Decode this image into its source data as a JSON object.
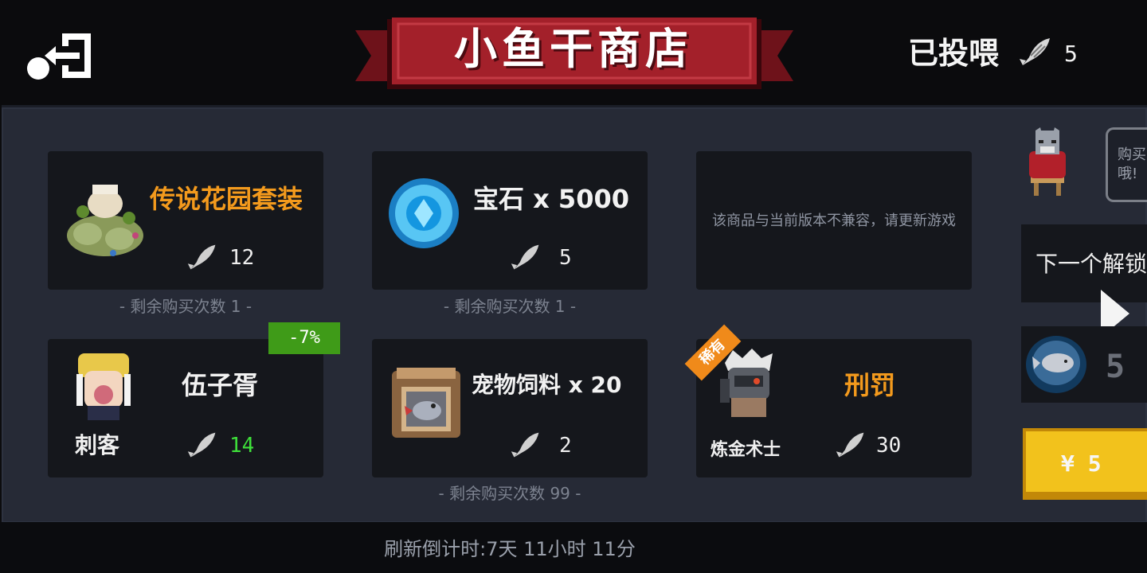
{
  "header": {
    "title": "小鱼干商店",
    "fed_label": "已投喂",
    "fed_count": "5"
  },
  "items": [
    {
      "name": "传说花园套装",
      "price": "12",
      "remaining": "- 剩余购买次数 1 -"
    },
    {
      "name": "宝石 x 5000",
      "price": "5",
      "remaining": "- 剩余购买次数 1 -"
    },
    {
      "incompatible_text": "该商品与当前版本不兼容，请更新游戏"
    },
    {
      "name": "伍子胥",
      "class_label": "刺客",
      "price": "14",
      "discount": "-7%"
    },
    {
      "name": "宠物饲料 x 20",
      "price": "2",
      "remaining": "- 剩余购买次数 99 -"
    },
    {
      "name": "刑罚",
      "class_label": "炼金术士",
      "price": "30",
      "tag": "稀有"
    }
  ],
  "side": {
    "speech_text": "购买\n哦!",
    "next_unlock": "下一个解锁",
    "count": "5",
    "buy_label": "¥ 5"
  },
  "footer": {
    "refresh": "刷新倒计时:7天 11小时 11分"
  },
  "colors": {
    "banner_red": "#a3202a",
    "orange_text": "#f39a1d",
    "green_price": "#3ee03a",
    "discount_bg": "#3f9b18",
    "panel_bg": "#262a36",
    "card_bg": "#15171c",
    "buy_button": "#f2c21c"
  }
}
